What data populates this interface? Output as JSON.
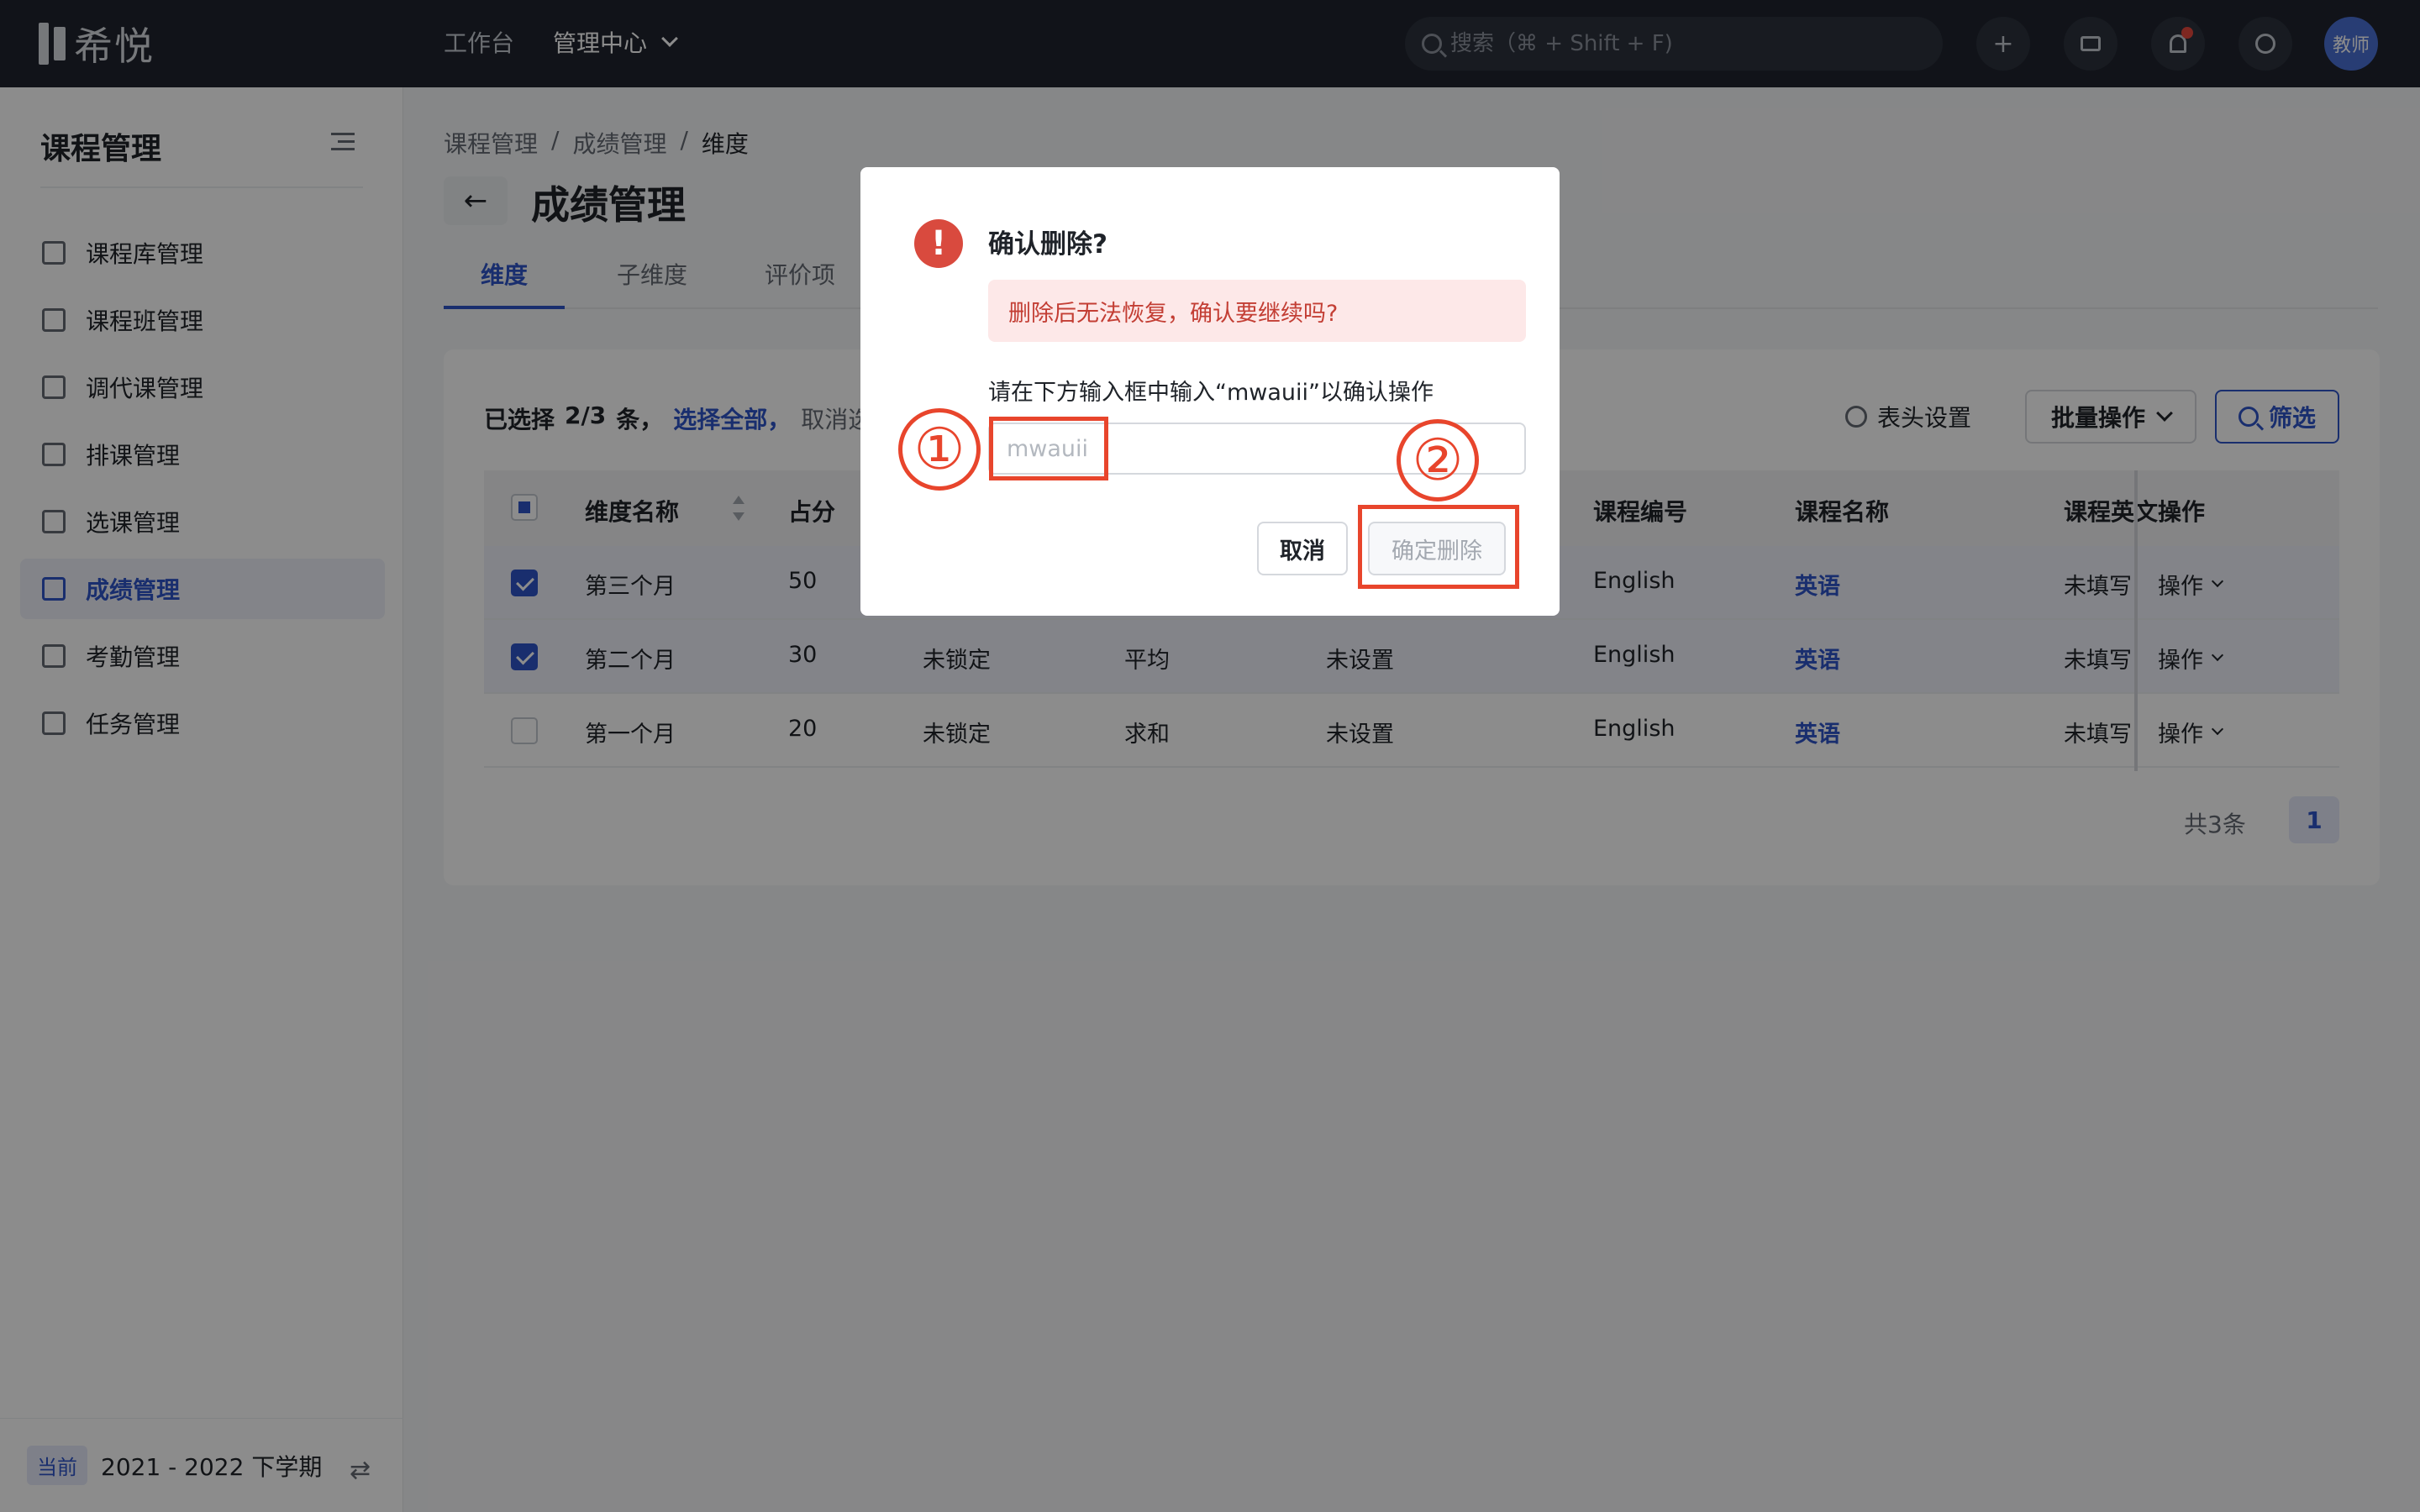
{
  "app": {
    "logo_text": "希悦"
  },
  "topbar": {
    "nav": [
      {
        "label": "工作台"
      },
      {
        "label": "管理中心"
      }
    ],
    "search_placeholder": "搜索（⌘ + Shift + F)",
    "avatar_label": "教师"
  },
  "sidebar": {
    "title": "课程管理",
    "items": [
      {
        "label": "课程库管理",
        "icon": "library-icon"
      },
      {
        "label": "课程班管理",
        "icon": "class-icon"
      },
      {
        "label": "调代课管理",
        "icon": "substitute-icon"
      },
      {
        "label": "排课管理",
        "icon": "schedule-icon"
      },
      {
        "label": "选课管理",
        "icon": "select-course-icon"
      },
      {
        "label": "成绩管理",
        "icon": "grade-icon",
        "active": true
      },
      {
        "label": "考勤管理",
        "icon": "attendance-icon"
      },
      {
        "label": "任务管理",
        "icon": "task-icon"
      }
    ],
    "footer": {
      "badge": "当前",
      "term": "2021 - 2022 下学期"
    }
  },
  "main": {
    "breadcrumb": [
      "课程管理",
      "成绩管理",
      "维度"
    ],
    "breadcrumb_sep": "/",
    "title": "成绩管理",
    "tabs": [
      {
        "label": "维度",
        "active": true
      },
      {
        "label": "子维度"
      },
      {
        "label": "评价项"
      }
    ],
    "selection": {
      "prefix": "已选择",
      "count": "2/3",
      "suffix": "条，",
      "select_all": "选择全部，",
      "cancel": "取消选择"
    },
    "toolbar": {
      "header_settings": "表头设置",
      "bulk_action": "批量操作",
      "filter": "筛选"
    },
    "table": {
      "columns": [
        "维度名称",
        "占分",
        "",
        "",
        "",
        "课程编号",
        "课程名称",
        "课程英文",
        "操作"
      ],
      "rows": [
        {
          "name": "第三个月",
          "score": "50",
          "lock": "",
          "method": "",
          "setting": "",
          "course_code": "English",
          "course_name": "英语",
          "course_en": "未填写",
          "op": "操作",
          "selected": true
        },
        {
          "name": "第二个月",
          "score": "30",
          "lock": "未锁定",
          "method": "平均",
          "setting": "未设置",
          "course_code": "English",
          "course_name": "英语",
          "course_en": "未填写",
          "op": "操作",
          "selected": true
        },
        {
          "name": "第一个月",
          "score": "20",
          "lock": "未锁定",
          "method": "求和",
          "setting": "未设置",
          "course_code": "English",
          "course_name": "英语",
          "course_en": "未填写",
          "op": "操作",
          "selected": false
        }
      ]
    },
    "pagination": {
      "total": "共3条",
      "current": "1"
    }
  },
  "modal": {
    "title": "确认删除?",
    "alert": "删除后无法恢复，确认要继续吗?",
    "hint": "请在下方输入框中输入“mwauii”以确认操作",
    "input_placeholder": "mwauii",
    "cancel_label": "取消",
    "confirm_label": "确定删除"
  },
  "annotations": {
    "step1": "①",
    "step2": "②",
    "color": "#e8452c"
  }
}
